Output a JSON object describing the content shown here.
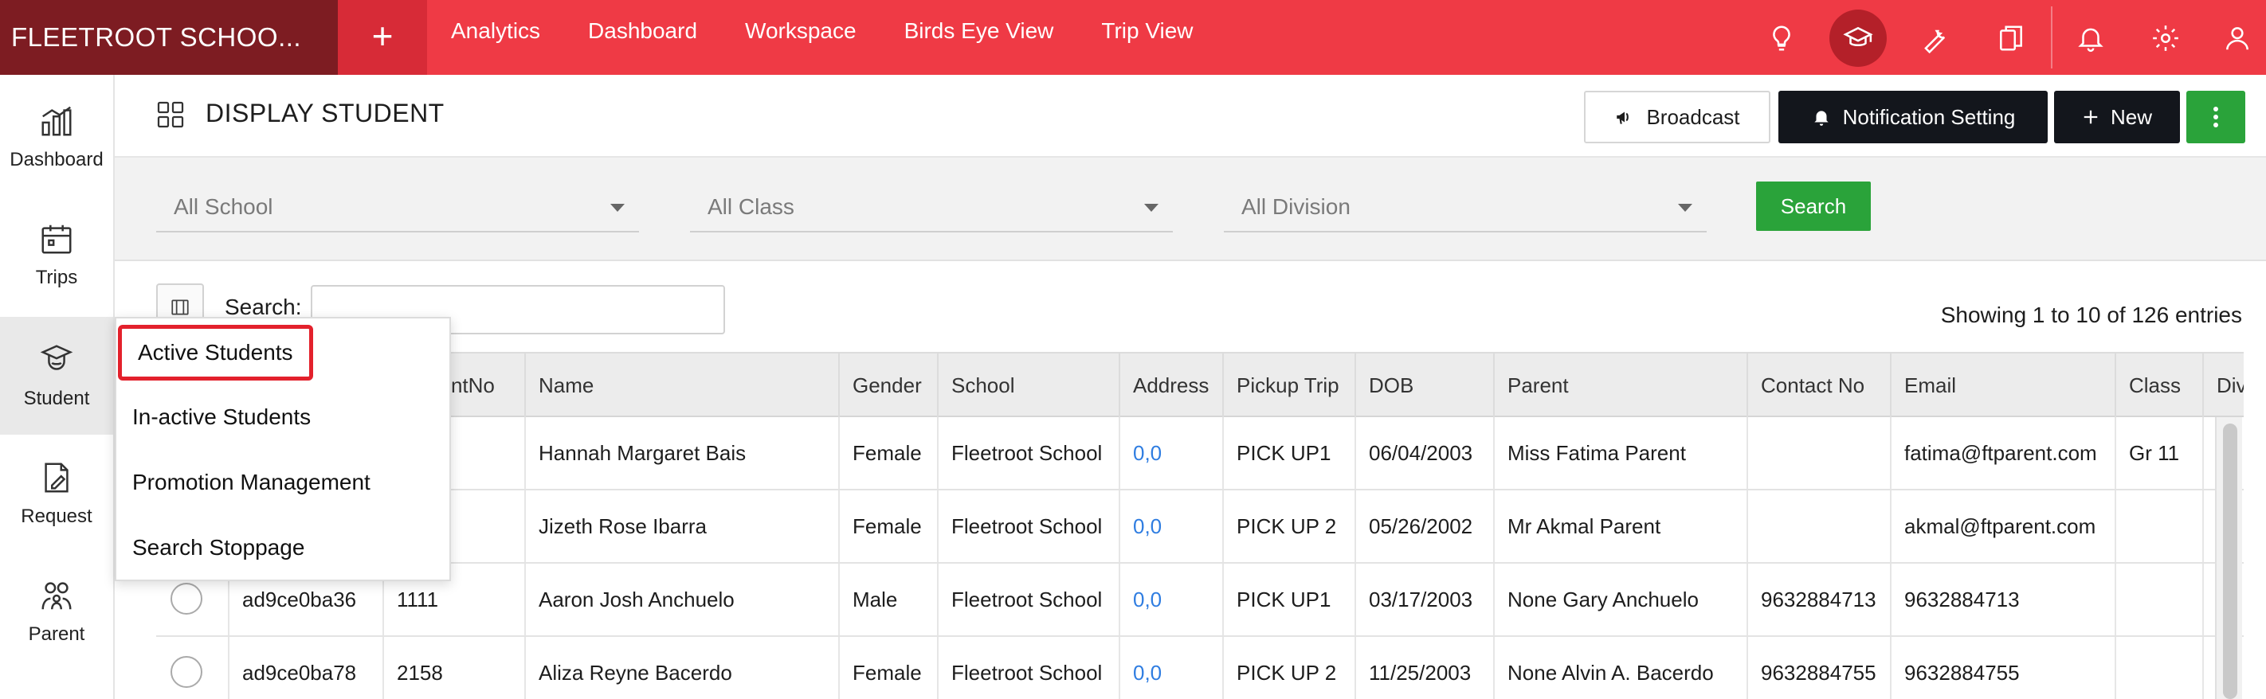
{
  "app": {
    "brand": "FLEETROOT SCHOO...",
    "add_label": "+"
  },
  "nav": {
    "items": [
      "Analytics",
      "Dashboard",
      "Workspace",
      "Birds Eye View",
      "Trip View"
    ]
  },
  "top_icons": [
    "lightbulb-icon",
    "graduation-cap-icon",
    "wrench-icon",
    "documents-icon",
    "bell-icon",
    "gear-icon",
    "user-icon"
  ],
  "sidebar": {
    "items": [
      {
        "label": "Dashboard",
        "icon": "bar-chart-icon"
      },
      {
        "label": "Trips",
        "icon": "calendar-icon"
      },
      {
        "label": "Student",
        "icon": "student-icon"
      },
      {
        "label": "Request",
        "icon": "request-document-icon"
      },
      {
        "label": "Parent",
        "icon": "parent-group-icon"
      }
    ],
    "active": "Student"
  },
  "header": {
    "title": "DISPLAY STUDENT",
    "broadcast_label": "Broadcast",
    "notification_label": "Notification Setting",
    "new_label": "New"
  },
  "filters": {
    "school": "All School",
    "class": "All Class",
    "division": "All Division",
    "search_button": "Search"
  },
  "table_tools": {
    "search_label": "Search:",
    "search_value": "",
    "entries_info": "Showing 1 to 10 of 126 entries"
  },
  "table": {
    "columns": [
      "",
      "",
      "StudentNo",
      "Name",
      "Gender",
      "School",
      "Address",
      "Pickup Trip",
      "DOB",
      "Parent",
      "Contact No",
      "Email",
      "Class",
      "Divisi"
    ],
    "rows": [
      [
        "",
        "",
        "",
        "Hannah Margaret Bais",
        "Female",
        "Fleetroot School",
        "0,0",
        "PICK UP1",
        "06/04/2003",
        "Miss Fatima Parent",
        "",
        "fatima@ftparent.com",
        "Gr 11",
        ""
      ],
      [
        "",
        "",
        "",
        "Jizeth Rose Ibarra",
        "Female",
        "Fleetroot School",
        "0,0",
        "PICK UP 2",
        "05/26/2002",
        "Mr Akmal Parent",
        "",
        "akmal@ftparent.com",
        "",
        ""
      ],
      [
        "",
        "ad9ce0ba36",
        "1111",
        "Aaron Josh Anchuelo",
        "Male",
        "Fleetroot School",
        "0,0",
        "PICK UP1",
        "03/17/2003",
        "None Gary Anchuelo",
        "9632884713",
        "9632884713",
        "",
        ""
      ],
      [
        "",
        "ad9ce0ba78",
        "2158",
        "Aliza Reyne Bacerdo",
        "Female",
        "Fleetroot School",
        "0,0",
        "PICK UP 2",
        "11/25/2003",
        "None Alvin A. Bacerdo",
        "9632884755",
        "9632884755",
        "",
        ""
      ]
    ]
  },
  "student_menu": {
    "items": [
      "Active Students",
      "In-active Students",
      "Promotion Management",
      "Search Stoppage"
    ],
    "highlighted": "Active Students"
  },
  "colors": {
    "topbar": "#ef3a45",
    "brand_bg": "#7d1c22",
    "green": "#2aa33a",
    "dark_button": "#13161c",
    "link": "#2f7de1",
    "highlight_border": "#e3212c"
  }
}
